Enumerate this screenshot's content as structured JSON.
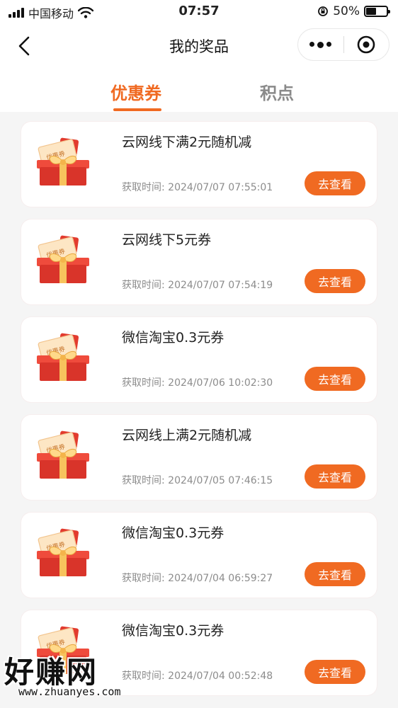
{
  "status_bar": {
    "carrier": "中国移动",
    "time": "07:57",
    "battery": "50%",
    "battery_level": 0.5
  },
  "nav": {
    "title": "我的奖品"
  },
  "tabs": [
    {
      "label": "优惠券",
      "active": true
    },
    {
      "label": "积点",
      "active": false
    }
  ],
  "colors": {
    "accent": "#f06a22",
    "muted": "#8c8c8c"
  },
  "items": [
    {
      "title": "云网线下满2元随机减",
      "time": "获取时间: 2024/07/07 07:55:01",
      "button": "去查看"
    },
    {
      "title": "云网线下5元券",
      "time": "获取时间: 2024/07/07 07:54:19",
      "button": "去查看"
    },
    {
      "title": "微信淘宝0.3元券",
      "time": "获取时间: 2024/07/06 10:02:30",
      "button": "去查看"
    },
    {
      "title": "云网线上满2元随机减",
      "time": "获取时间: 2024/07/05 07:46:15",
      "button": "去查看"
    },
    {
      "title": "微信淘宝0.3元券",
      "time": "获取时间: 2024/07/04 06:59:27",
      "button": "去查看"
    },
    {
      "title": "微信淘宝0.3元券",
      "time": "获取时间: 2024/07/04 00:52:48",
      "button": "去查看"
    }
  ],
  "gift_label": "优惠券",
  "watermark": {
    "brand": "好赚网",
    "url": "www.zhuanyes.com"
  }
}
